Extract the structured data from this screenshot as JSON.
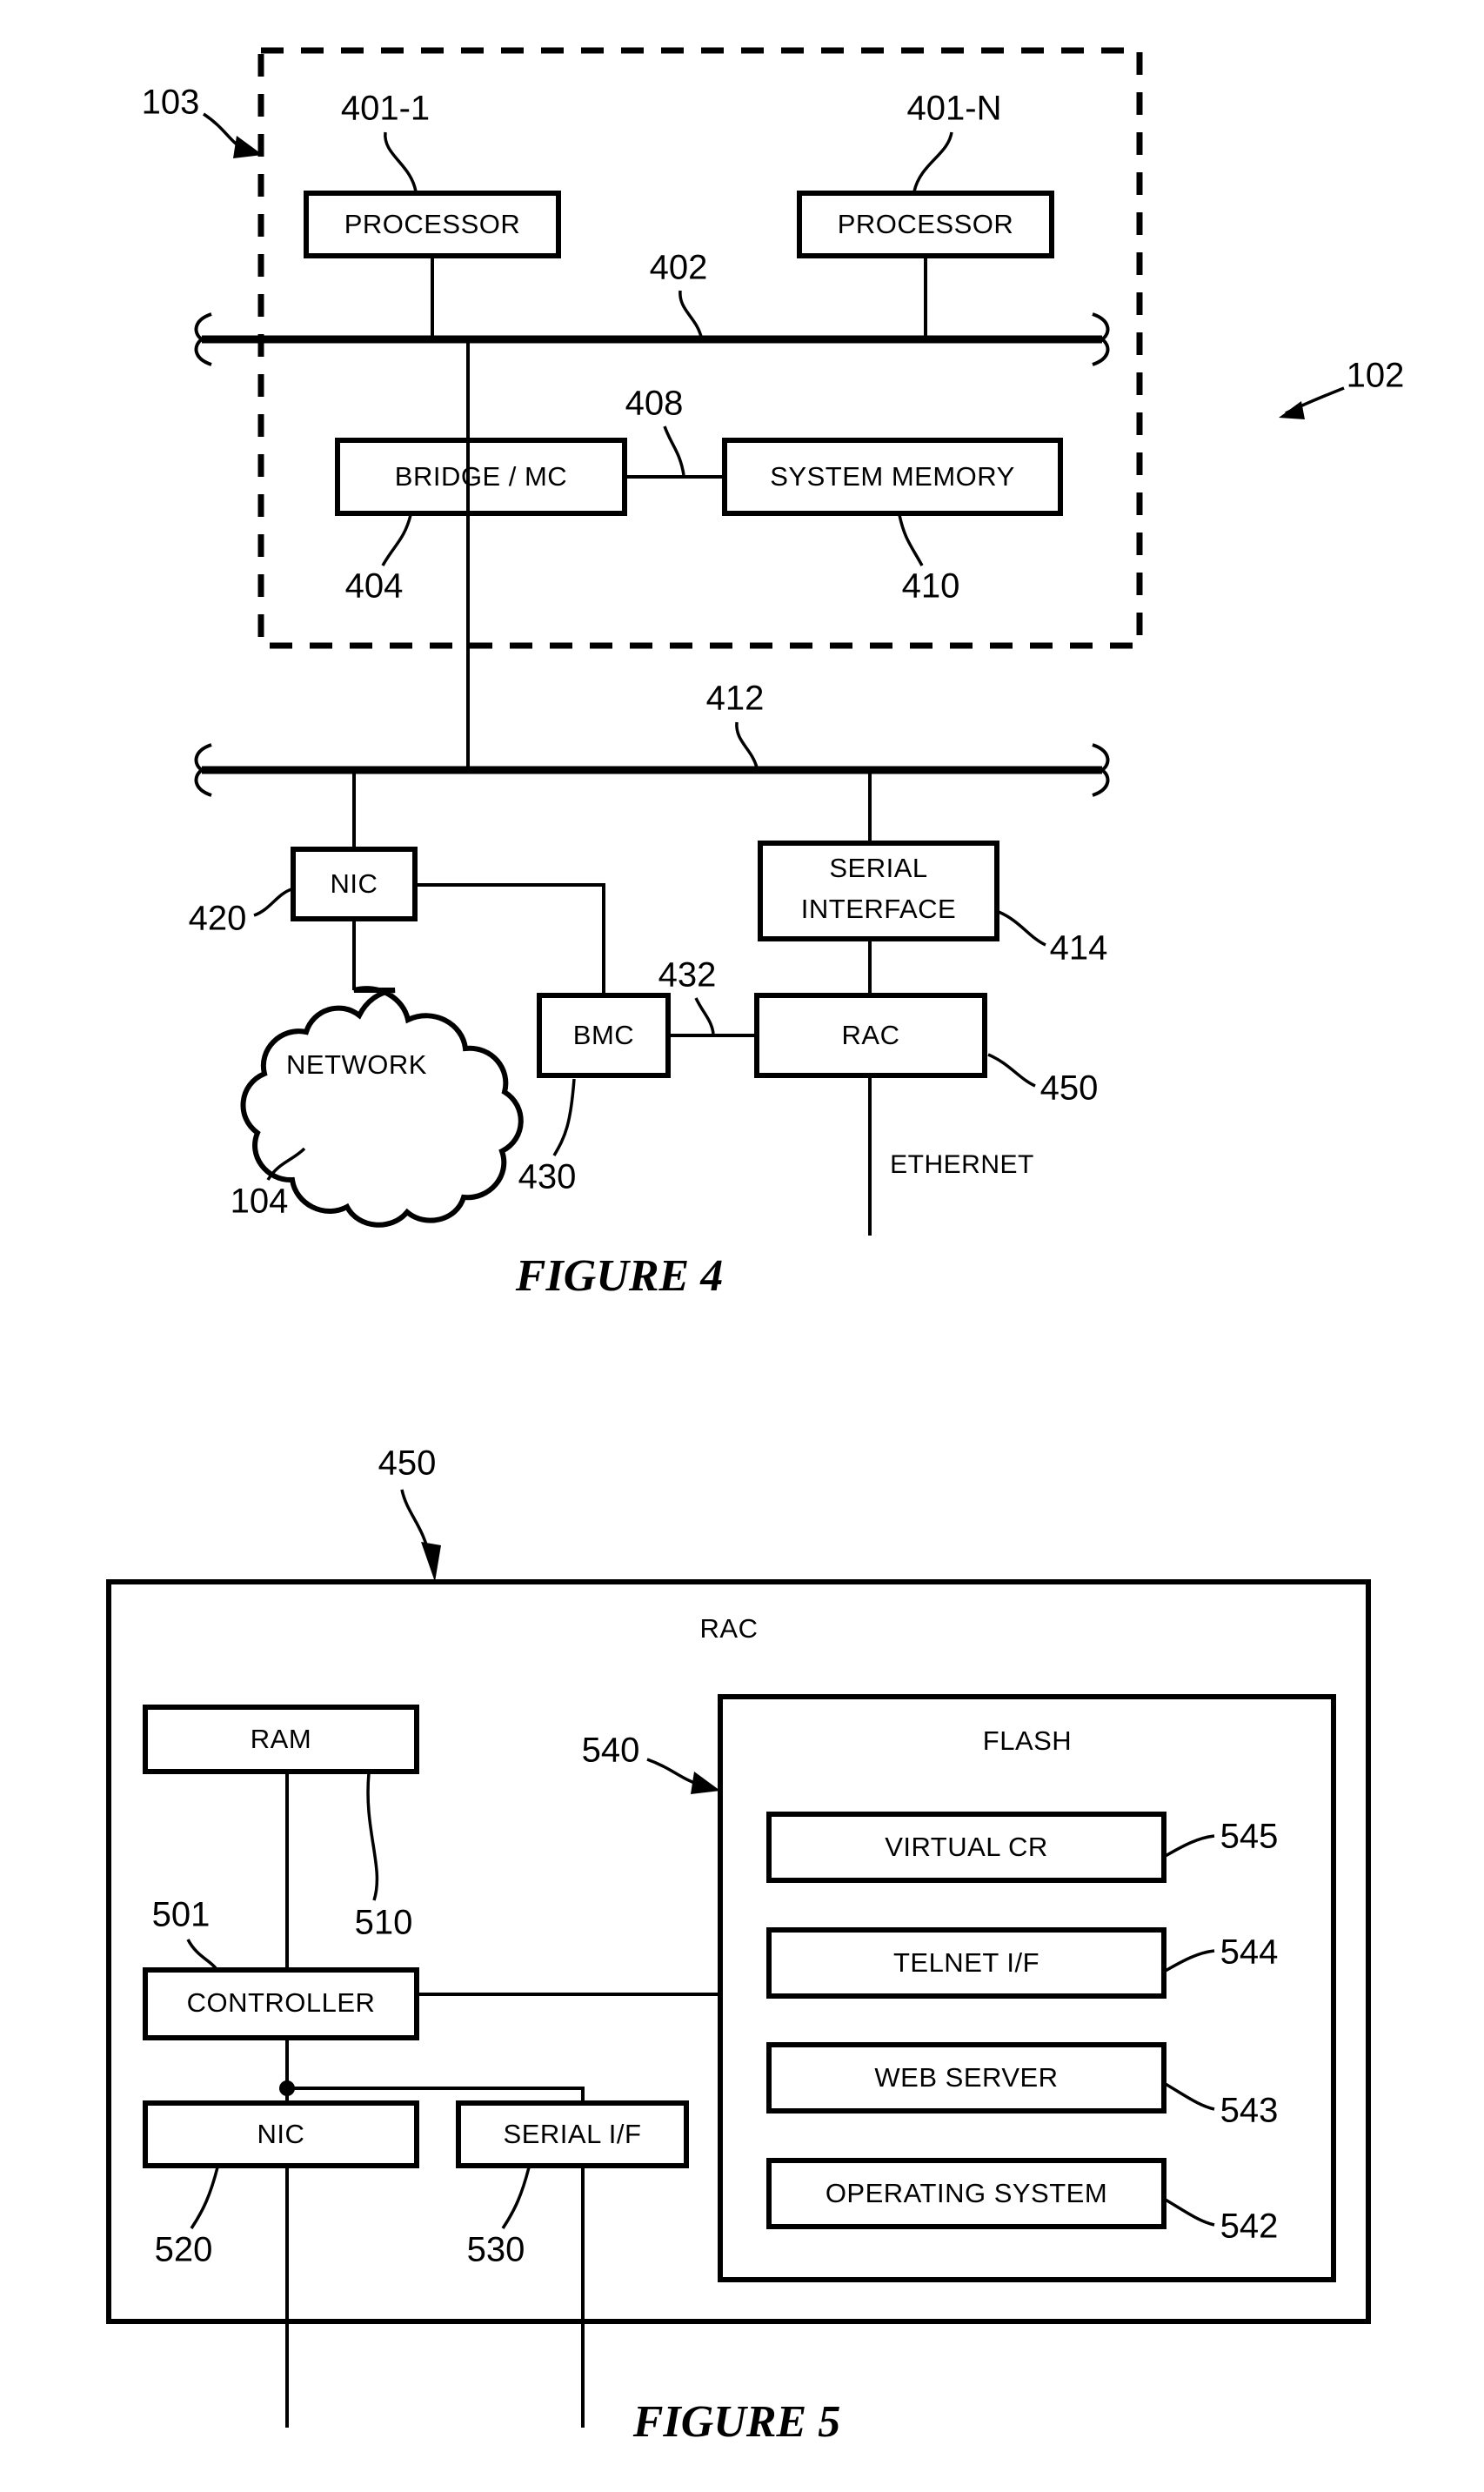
{
  "figure4": {
    "caption": "FIGURE 4",
    "refs": {
      "system": "103",
      "outer": "102",
      "cpu_bus": "402",
      "proc1": "401-1",
      "procN": "401-N",
      "bridge": "404",
      "mem_link": "408",
      "memory": "410",
      "io_bus": "412",
      "nic": "420",
      "serial_interface": "414",
      "bmc": "430",
      "bmc_rac_link": "432",
      "rac": "450",
      "network": "104"
    },
    "blocks": {
      "processor1": "PROCESSOR",
      "processorN": "PROCESSOR",
      "bridge_mc": "BRIDGE / MC",
      "system_memory": "SYSTEM MEMORY",
      "nic": "NIC",
      "serial_interface_line1": "SERIAL",
      "serial_interface_line2": "INTERFACE",
      "bmc": "BMC",
      "rac": "RAC",
      "network": "NETWORK",
      "ethernet": "ETHERNET"
    }
  },
  "figure5": {
    "caption": "FIGURE 5",
    "title": "RAC",
    "refs": {
      "rac": "450",
      "controller": "501",
      "ram": "510",
      "nic": "520",
      "serial_if": "530",
      "flash": "540",
      "operating_system": "542",
      "web_server": "543",
      "telnet_if": "544",
      "virtual_cr": "545"
    },
    "blocks": {
      "ram": "RAM",
      "controller": "CONTROLLER",
      "nic": "NIC",
      "serial_if": "SERIAL I/F",
      "flash": "FLASH",
      "virtual_cr": "VIRTUAL CR",
      "telnet_if": "TELNET I/F",
      "web_server": "WEB SERVER",
      "operating_system": "OPERATING SYSTEM"
    }
  }
}
